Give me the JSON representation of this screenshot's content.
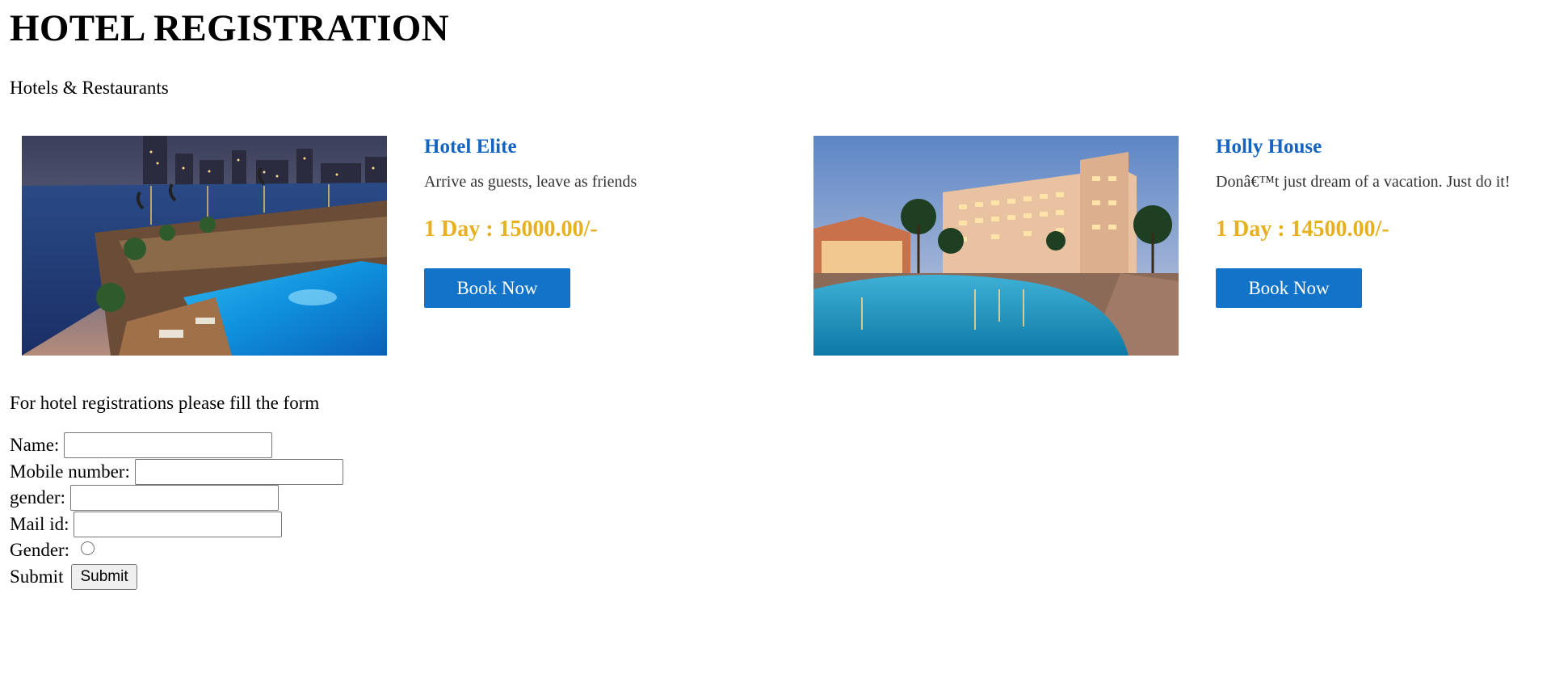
{
  "page": {
    "title": "HOTEL REGISTRATION",
    "subtitle": "Hotels & Restaurants"
  },
  "hotels": [
    {
      "name": "Hotel Elite",
      "tagline": "Arrive as guests, leave as friends",
      "price": "1 Day : 15000.00/-",
      "button_label": "Book Now"
    },
    {
      "name": "Holly House",
      "tagline": "Donâ€™t just dream of a vacation. Just do it!",
      "price": "1 Day : 14500.00/-",
      "button_label": "Book Now"
    }
  ],
  "form": {
    "intro": "For hotel registrations please fill the form",
    "fields": [
      {
        "label": "Name:",
        "value": ""
      },
      {
        "label": "Mobile number:",
        "value": ""
      },
      {
        "label": "gender:",
        "value": ""
      },
      {
        "label": "Mail id:",
        "value": ""
      }
    ],
    "radio_label": "Gender:",
    "submit_label": "Submit",
    "submit_button": "Submit"
  },
  "colors": {
    "hotel_name": "#1565c0",
    "price": "#e6b020",
    "book_button": "#1273c8"
  }
}
